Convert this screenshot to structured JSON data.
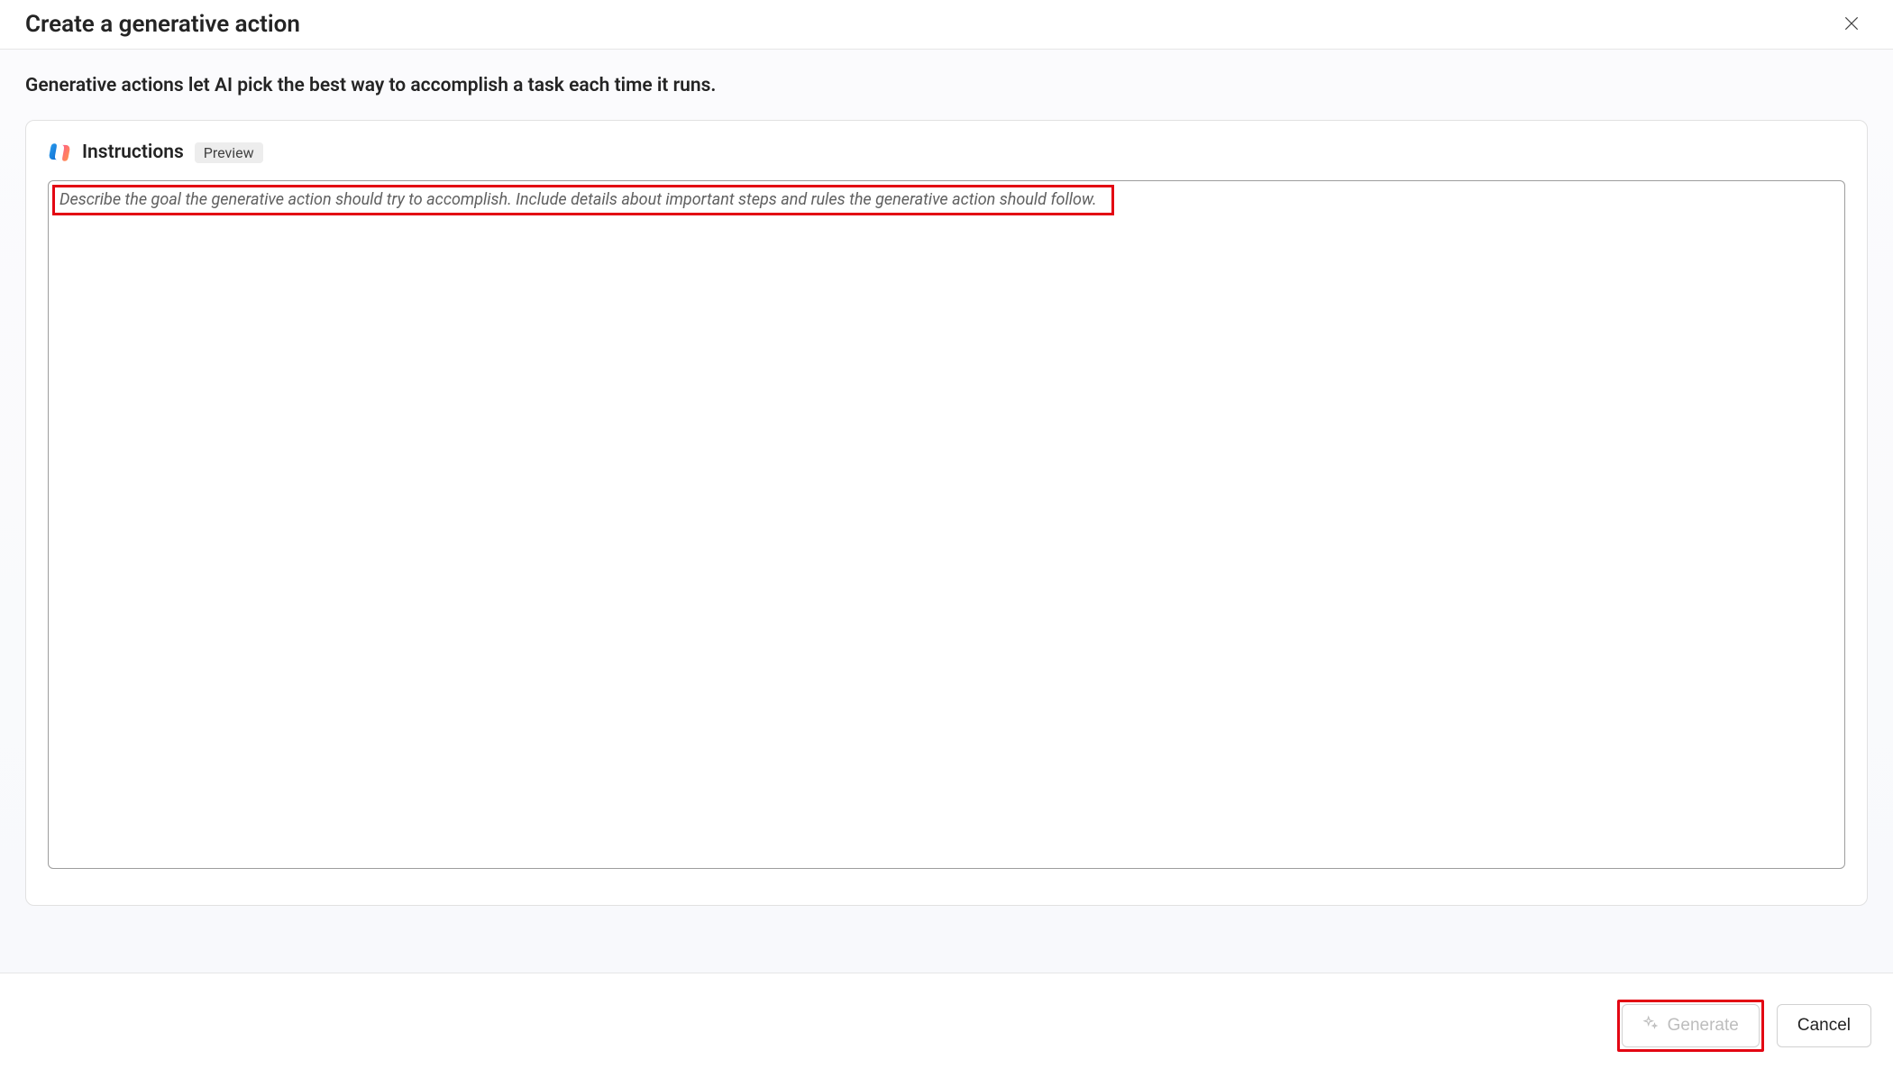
{
  "header": {
    "title": "Create a generative action"
  },
  "description": "Generative actions let AI pick the best way to accomplish a task each time it runs.",
  "instructions": {
    "label": "Instructions",
    "badge": "Preview",
    "placeholder": "Describe the goal the generative action should try to accomplish. Include details about important steps and rules the generative action should follow."
  },
  "footer": {
    "generate_label": "Generate",
    "cancel_label": "Cancel"
  }
}
